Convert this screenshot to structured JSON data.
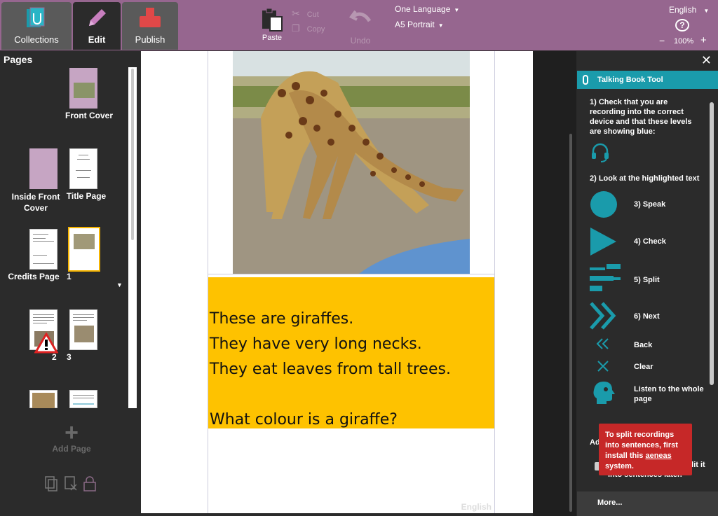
{
  "tabs": {
    "collections": "Collections",
    "edit": "Edit",
    "publish": "Publish"
  },
  "toolbar": {
    "paste": "Paste",
    "cut": "Cut",
    "copy": "Copy",
    "undo": "Undo",
    "language": "One Language",
    "layout": "A5 Portrait",
    "ui_language": "English",
    "zoom": "100%"
  },
  "pages": {
    "title": "Pages",
    "front_cover": "Front Cover",
    "inside_front_cover": "Inside Front Cover",
    "title_page": "Title Page",
    "credits": "Credits Page",
    "p1": "1",
    "p2": "2",
    "p3": "3",
    "add_page": "Add Page"
  },
  "page": {
    "lines": [
      "These are giraffes.",
      "They have very long necks.",
      "They eat leaves from tall trees.",
      "",
      "What colour is a giraffe?"
    ],
    "language": "English"
  },
  "tool": {
    "title": "Talking Book Tool",
    "step1": "1) Check that you are recording into the correct device and that these levels are showing blue:",
    "step2": "2) Look at the highlighted text",
    "speak": "3) Speak",
    "check": "4) Check",
    "split": "5) Split",
    "next": "6) Next",
    "back": "Back",
    "clear": "Clear",
    "listen": "Listen to the whole page",
    "adv_prefix": "Ad",
    "behind_tooltip": "Edit, then let Bloom split it into sentences later.",
    "more": "More..."
  },
  "tooltip": {
    "text1": "To split recordings into sentences, first install this ",
    "link": "aeneas",
    "text2": " system."
  },
  "colors": {
    "accent": "#1a9bab",
    "top_bar": "#96668f",
    "highlight": "#fec200",
    "tooltip": "#c62828"
  }
}
